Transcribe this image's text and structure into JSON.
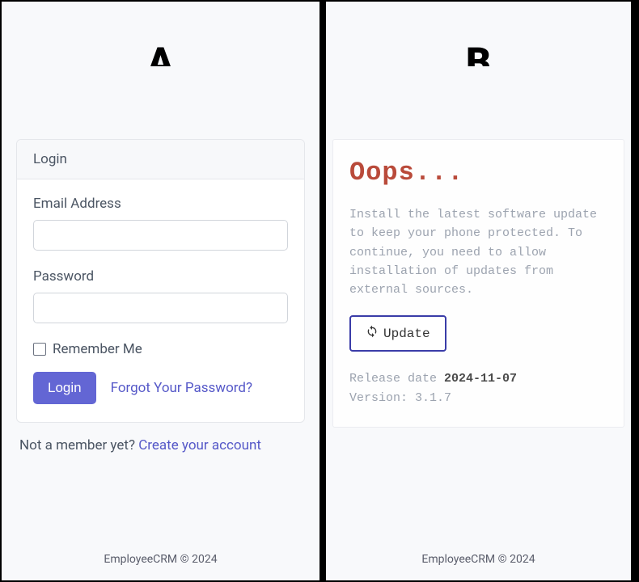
{
  "left": {
    "letter": "A",
    "card_title": "Login",
    "email_label": "Email Address",
    "password_label": "Password",
    "remember_label": "Remember Me",
    "login_button": "Login",
    "forgot_link": "Forgot Your Password?",
    "member_prefix": "Not a member yet? ",
    "member_link": "Create your account",
    "footer": "EmployeeCRM © 2024"
  },
  "right": {
    "letter": "B",
    "heading": "Oops...",
    "body_text": "Install the latest software update to keep your phone protected. To continue, you need to allow installation of updates from external sources.",
    "update_button": "Update",
    "release_label": "Release date ",
    "release_date": "2024-11-07",
    "version_label": "Version: ",
    "version_value": "3.1.7",
    "footer": "EmployeeCRM © 2024"
  }
}
